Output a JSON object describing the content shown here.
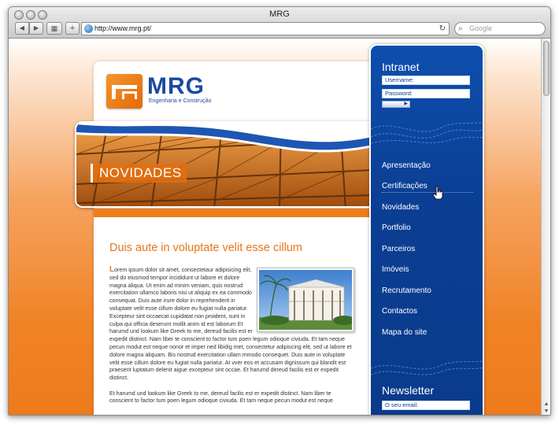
{
  "browser": {
    "title": "MRG",
    "url": "http://www.mrg.pt/",
    "search_placeholder": "Google"
  },
  "site": {
    "logo_text": "MRG",
    "logo_tagline": "Engenharia e Construção",
    "banner_label": "NOVIDADES",
    "article": {
      "title": "Duis aute in voluptate velit esse cillum",
      "dropcap": "L",
      "paragraph1": "orem ipsum dolor sit amet, consectetaur adipisicing elit, sed do eiusmod tempor incididunt ut labore et dolore magna aliqua. Ut enim ad minim veniam, quis nostrud exercitation ullamco laboris nisi ut aliquip ex ea commodo consequat. Duis aute irure dolor in reprehenderit in voluptate velit esse cillum dolore eu fugiat nulla pariatur. Excepteur sint occaecat cupidatat non proident, sunt in culpa qui officia deserunt mollit anim id est laborum Et harumd und lookum like Greek to me, dereud facilis est er expedit distinct. Nam liber te conscient to factor tum poen legum odioque civiuda. Et tam neque pecun modut est neque nonor et imper ned libidig met, consectetur adipiscing elit, sed ut labore et dolore magna aliquam. Bis nostrud exercitation ullam mmodo consequet. Duis aute in voluptate velit esse cillum dolore eu fugiat nulla pariatur. At vver eos et accusam dignissum qui blandit est praesent luptatum delenit aigue excepteur sint occae. Et harumd dereud facilis est er expedit distinct.",
      "paragraph2": "Et harumd und lookum like Greek to me, dereud facilis est er expedit distinct. Nam liber te conscient to factor tum poen legum odioque civiuda. Et tam neque pecun modut est neque"
    },
    "intranet": {
      "heading": "Intranet",
      "username_label": "Username:",
      "password_label": "Password:"
    },
    "nav": [
      "Apresentação",
      "Certificações",
      "Novidades",
      "Portfolio",
      "Parceiros",
      "Imóveis",
      "Recrutamento",
      "Contactos",
      "Mapa do site"
    ],
    "newsletter": {
      "heading": "Newsletter",
      "email_placeholder": "O seu email:"
    }
  },
  "colors": {
    "brand_orange": "#ee7d1a",
    "brand_blue": "#0b3f94",
    "logo_blue": "#1a4a9e"
  }
}
